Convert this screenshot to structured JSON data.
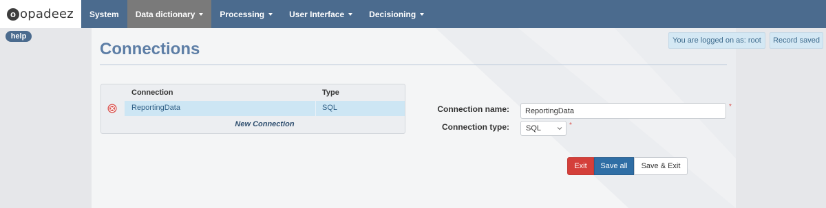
{
  "brand": {
    "logo_letter": "o",
    "name": "opadeez"
  },
  "nav": [
    {
      "label": "System",
      "dropdown": false,
      "active": false
    },
    {
      "label": "Data dictionary",
      "dropdown": true,
      "active": true
    },
    {
      "label": "Processing",
      "dropdown": true,
      "active": false
    },
    {
      "label": "User Interface",
      "dropdown": true,
      "active": false
    },
    {
      "label": "Decisioning",
      "dropdown": true,
      "active": false
    }
  ],
  "help_label": "help",
  "page_title": "Connections",
  "status": {
    "logged_in": "You are logged on as: root",
    "record_saved": "Record saved"
  },
  "table": {
    "headers": {
      "connection": "Connection",
      "type": "Type"
    },
    "rows": [
      {
        "connection": "ReportingData",
        "type": "SQL",
        "delete_icon": "delete-circle-icon"
      }
    ],
    "new_label": "New Connection"
  },
  "form": {
    "name_label": "Connection name:",
    "name_value": "ReportingData",
    "type_label": "Connection type:",
    "type_value": "SQL",
    "required_mark": "*"
  },
  "buttons": {
    "exit": "Exit",
    "save_all": "Save all",
    "save_exit": "Save & Exit"
  },
  "colors": {
    "navbar": "#4b6b8e",
    "accent": "#5d7ea6",
    "exit": "#d43f3a",
    "save": "#2f6ea5",
    "selected_row": "#cde6f4"
  }
}
